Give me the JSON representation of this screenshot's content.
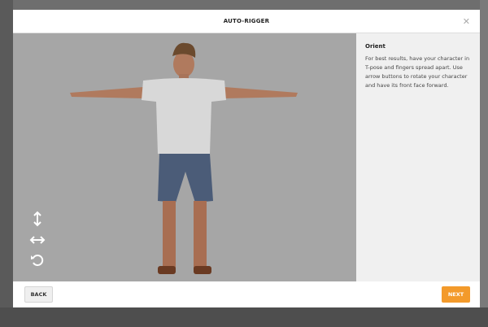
{
  "modal": {
    "title": "AUTO-RIGGER",
    "close_icon": "close-icon"
  },
  "sidebar": {
    "heading": "Orient",
    "text": "For best results, have your character in T-pose and fingers spread apart. Use arrow buttons to rotate your character and have its front face forward."
  },
  "controls": {
    "vertical": "arrow-vertical-icon",
    "horizontal": "arrow-horizontal-icon",
    "rotate": "rotate-icon"
  },
  "footer": {
    "back_label": "BACK",
    "next_label": "NEXT"
  },
  "colors": {
    "accent": "#f39a2b"
  }
}
